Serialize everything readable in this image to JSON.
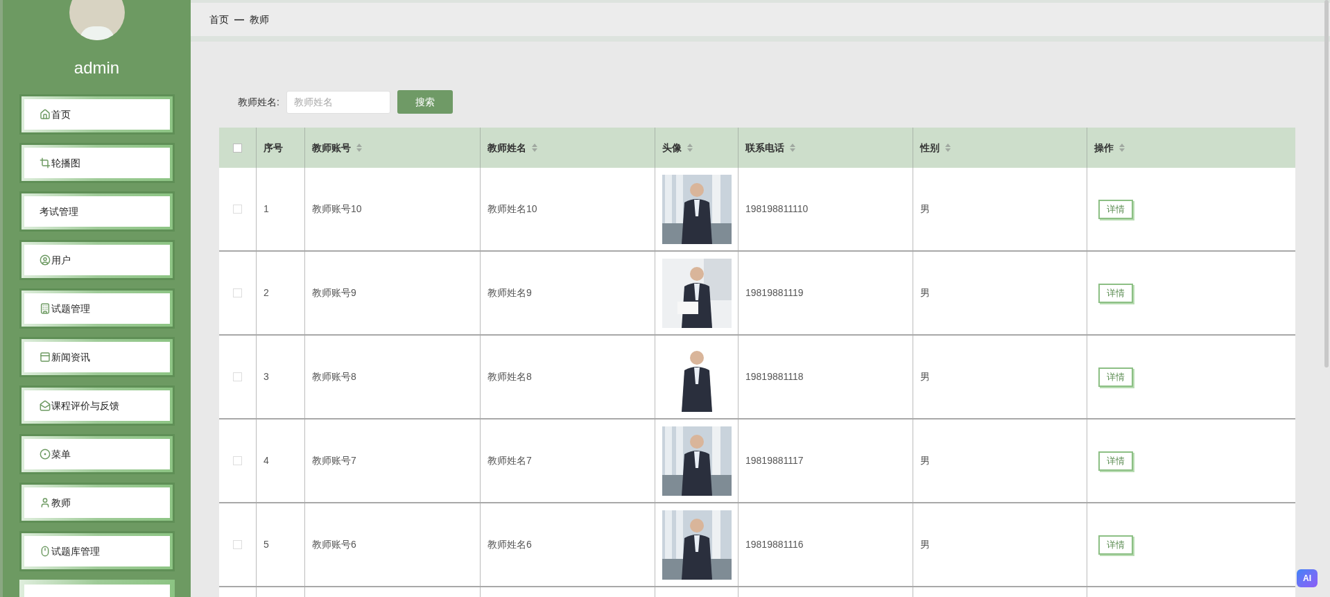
{
  "sidebar": {
    "user": "admin",
    "items": [
      {
        "label": "首页"
      },
      {
        "label": "轮播图"
      },
      {
        "label": "考试管理"
      },
      {
        "label": "用户"
      },
      {
        "label": "试题管理"
      },
      {
        "label": "新闻资讯"
      },
      {
        "label": "课程评价与反馈"
      },
      {
        "label": "菜单"
      },
      {
        "label": "教师"
      },
      {
        "label": "试题库管理"
      }
    ]
  },
  "breadcrumb": [
    "首页",
    "—",
    "教师"
  ],
  "search": {
    "label": "教师姓名:",
    "placeholder": "教师姓名",
    "button": "搜索"
  },
  "table": {
    "select_all": {
      "checked": false
    },
    "columns": [
      {
        "label": "序号",
        "sortable": false
      },
      {
        "label": "教师账号",
        "sortable": true
      },
      {
        "label": "教师姓名",
        "sortable": true
      },
      {
        "label": "头像",
        "sortable": true
      },
      {
        "label": "联系电话",
        "sortable": true
      },
      {
        "label": "性别",
        "sortable": true
      },
      {
        "label": "操作",
        "sortable": true
      }
    ],
    "rows": [
      {
        "checked": false,
        "no": "1",
        "account": "教师账号10",
        "name": "教师姓名10",
        "phone": "198198811110",
        "gender": "男",
        "action": "详情"
      },
      {
        "checked": false,
        "no": "2",
        "account": "教师账号9",
        "name": "教师姓名9",
        "phone": "19819881119",
        "gender": "男",
        "action": "详情"
      },
      {
        "checked": false,
        "no": "3",
        "account": "教师账号8",
        "name": "教师姓名8",
        "phone": "19819881118",
        "gender": "男",
        "action": "详情"
      },
      {
        "checked": false,
        "no": "4",
        "account": "教师账号7",
        "name": "教师姓名7",
        "phone": "19819881117",
        "gender": "男",
        "action": "详情"
      },
      {
        "checked": false,
        "no": "5",
        "account": "教师账号6",
        "name": "教师姓名6",
        "phone": "19819881116",
        "gender": "男",
        "action": "详情"
      }
    ]
  },
  "ai_badge": "AI"
}
